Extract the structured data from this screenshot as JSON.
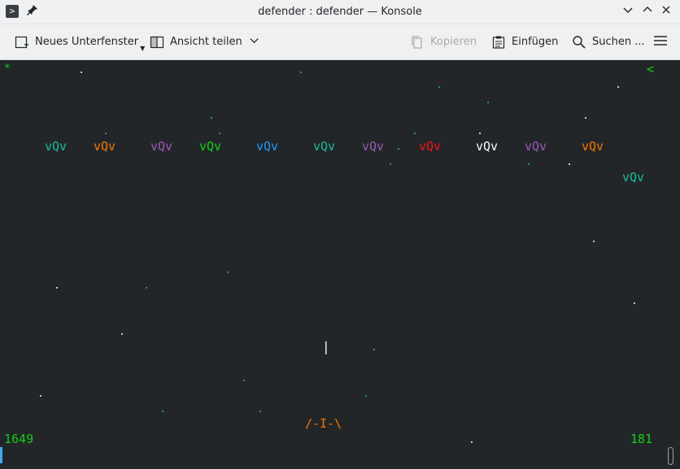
{
  "window": {
    "title": "defender : defender — Konsole",
    "icons": {
      "app": "konsole-icon",
      "pin": "pin-icon",
      "minimize": "chevron-down-icon",
      "maximize": "chevron-up-icon",
      "close": "close-icon"
    }
  },
  "toolbar": {
    "new_window_label": "Neues Unterfenster",
    "split_view_label": "Ansicht teilen",
    "copy_label": "Kopieren",
    "paste_label": "Einfügen",
    "search_label": "Suchen ..."
  },
  "terminal": {
    "background": "#232629",
    "corner_left": "*",
    "corner_right": "<",
    "score": "1649",
    "counter": "181",
    "player_ship": "/-I-\\",
    "laser": "|",
    "enemies": [
      {
        "text": "vQv",
        "color": "#1abc9c"
      },
      {
        "text": "vQv",
        "color": "#f67400"
      },
      {
        "text": "vQv",
        "color": "#9b59b6"
      },
      {
        "text": "vQv",
        "color": "#11d116"
      },
      {
        "text": "vQv",
        "color": "#1d99f3"
      },
      {
        "text": "vQv",
        "color": "#1abc9c"
      },
      {
        "text": "vQv",
        "color": "#9b59b6"
      },
      {
        "text": "vQv",
        "color": "#ed1515"
      },
      {
        "text": "vQv",
        "color": "#fcfcfc"
      },
      {
        "text": "vQv",
        "color": "#9b59b6"
      },
      {
        "text": "vQv",
        "color": "#f67400"
      },
      {
        "text": "vQv",
        "color": "#1abc9c"
      }
    ],
    "colors": {
      "hud": "#11d116",
      "ship": "#f67400",
      "star_white": "#fcfcfc",
      "star_teal": "#1abc9c"
    }
  }
}
